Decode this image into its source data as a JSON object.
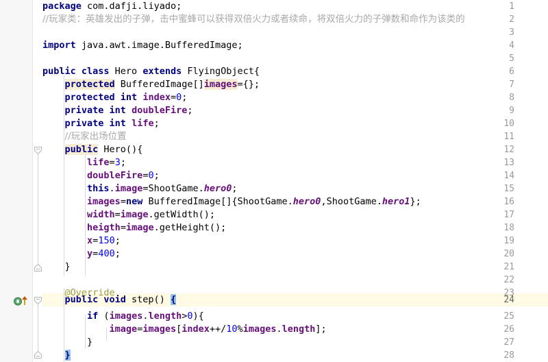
{
  "editor": {
    "app": "code-editor",
    "language": "java",
    "theme_name": "IntelliJ Light",
    "line_height_px": 19,
    "first_line": 1,
    "caret_line": 24,
    "colors": {
      "background": "#ffffff",
      "gutter_background": "#f7f7f7",
      "line_number": "#999999",
      "keyword": "#000080",
      "field": "#660e7a",
      "comment": "#a8a8a8",
      "number": "#0000ff",
      "annotation": "#9e9e3f",
      "identifier_search_highlight": "#f6ecd3",
      "caret_row_highlight": "#fffae3",
      "brace_match_highlight": "#93c3e8",
      "indent_guide": "#d8d8d8"
    },
    "gutter_icons": [
      {
        "line": 24,
        "name": "overriding-method-icon",
        "tooltip": "Overrides method in FlyingObject"
      }
    ],
    "fold_markers": [
      {
        "line": 12,
        "state": "expanded"
      },
      {
        "line": 21,
        "state": "expanded"
      },
      {
        "line": 24,
        "state": "expanded"
      },
      {
        "line": 28,
        "state": "expanded"
      }
    ],
    "line_numbers": [
      1,
      2,
      3,
      4,
      5,
      6,
      7,
      8,
      9,
      10,
      11,
      12,
      13,
      14,
      15,
      16,
      17,
      18,
      19,
      20,
      21,
      22,
      23,
      24,
      25,
      26,
      27,
      28
    ],
    "lines": [
      {
        "n": 1,
        "text": "package com.dafji.liyado;"
      },
      {
        "n": 2,
        "text": "//玩家类：英雄发出的子弹，击中蜜蜂可以获得双倍火力或者续命，将双倍火力的子弹数和命作为该类的"
      },
      {
        "n": 3,
        "text": ""
      },
      {
        "n": 4,
        "text": "import java.awt.image.BufferedImage;"
      },
      {
        "n": 5,
        "text": ""
      },
      {
        "n": 6,
        "text": "public class Hero extends FlyingObject{"
      },
      {
        "n": 7,
        "text": "    protected BufferedImage[]images={};"
      },
      {
        "n": 8,
        "text": "    protected int index=0;"
      },
      {
        "n": 9,
        "text": "    private int doubleFire;"
      },
      {
        "n": 10,
        "text": "    private int life;"
      },
      {
        "n": 11,
        "text": "    //玩家出场位置"
      },
      {
        "n": 12,
        "text": "    public Hero(){"
      },
      {
        "n": 13,
        "text": "        life=3;"
      },
      {
        "n": 14,
        "text": "        doubleFire=0;"
      },
      {
        "n": 15,
        "text": "        this.image=ShootGame.hero0;"
      },
      {
        "n": 16,
        "text": "        images=new BufferedImage[]{ShootGame.hero0,ShootGame.hero1};"
      },
      {
        "n": 17,
        "text": "        width=image.getWidth();"
      },
      {
        "n": 18,
        "text": "        heigth=image.getHeight();"
      },
      {
        "n": 19,
        "text": "        x=150;"
      },
      {
        "n": 20,
        "text": "        y=400;"
      },
      {
        "n": 21,
        "text": "    }"
      },
      {
        "n": 22,
        "text": ""
      },
      {
        "n": 23,
        "text": "    @Override"
      },
      {
        "n": 24,
        "text": "    public void step() {"
      },
      {
        "n": 25,
        "text": "        if (images.length>0){"
      },
      {
        "n": 26,
        "text": "            image=images[index++/10%images.length];"
      },
      {
        "n": 27,
        "text": "        }"
      },
      {
        "n": 28,
        "text": "    }"
      }
    ]
  }
}
